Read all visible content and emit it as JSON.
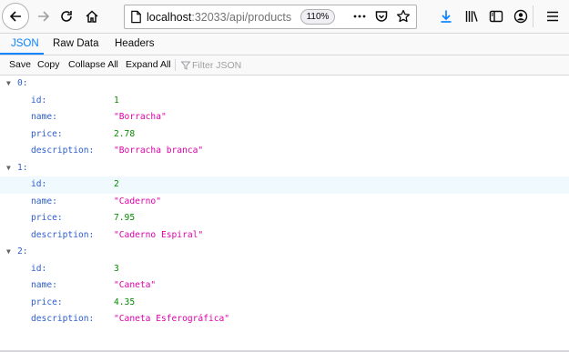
{
  "browser": {
    "url_host": "localhost",
    "url_path": ":32033/api/products",
    "zoom_level": "110%",
    "icons": {
      "back": "back-arrow-icon",
      "forward": "forward-arrow-icon",
      "reload": "reload-icon",
      "home": "home-icon",
      "site_info": "page-info-icon",
      "page_actions": "more-dots-icon",
      "pocket": "pocket-icon",
      "bookmark": "bookmark-star-icon",
      "downloads": "download-arrow-icon",
      "library": "library-icon",
      "sidebar": "sidebar-icon",
      "account": "account-icon",
      "menu": "hamburger-menu-icon"
    },
    "accent_color": "#0a84ff"
  },
  "viewer": {
    "tabs": [
      {
        "label": "JSON",
        "active": true
      },
      {
        "label": "Raw Data",
        "active": false
      },
      {
        "label": "Headers",
        "active": false
      }
    ],
    "actions": {
      "save": "Save",
      "copy": "Copy",
      "collapse_all": "Collapse All",
      "expand_all": "Expand All",
      "filter_placeholder": "Filter JSON"
    }
  },
  "products": [
    {
      "index": "0:",
      "fields": [
        {
          "key": "id:",
          "value": "1",
          "type": "number"
        },
        {
          "key": "name:",
          "value": "\"Borracha\"",
          "type": "string"
        },
        {
          "key": "price:",
          "value": "2.78",
          "type": "number"
        },
        {
          "key": "description:",
          "value": "\"Borracha branca\"",
          "type": "string"
        }
      ]
    },
    {
      "index": "1:",
      "fields": [
        {
          "key": "id:",
          "value": "2",
          "type": "number"
        },
        {
          "key": "name:",
          "value": "\"Caderno\"",
          "type": "string"
        },
        {
          "key": "price:",
          "value": "7.95",
          "type": "number"
        },
        {
          "key": "description:",
          "value": "\"Caderno Espiral\"",
          "type": "string"
        }
      ]
    },
    {
      "index": "2:",
      "fields": [
        {
          "key": "id:",
          "value": "3",
          "type": "number"
        },
        {
          "key": "name:",
          "value": "\"Caneta\"",
          "type": "string"
        },
        {
          "key": "price:",
          "value": "4.35",
          "type": "number"
        },
        {
          "key": "description:",
          "value": "\"Caneta Esferográfica\"",
          "type": "string"
        }
      ]
    }
  ],
  "colors": {
    "key": "#2c5dcd",
    "number": "#058b00",
    "string": "#dd00a9",
    "row_highlight": "#f0f9fe"
  }
}
